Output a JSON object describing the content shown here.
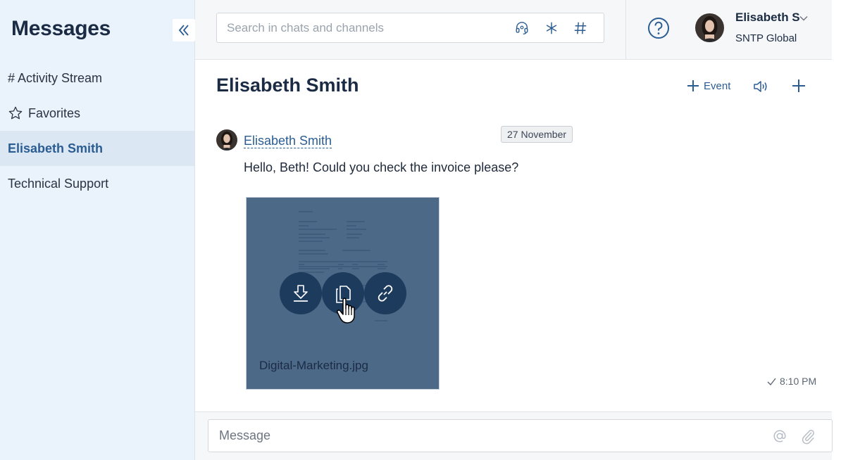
{
  "sidebar": {
    "title": "Messages",
    "items": [
      {
        "label": "# Activity Stream",
        "icon": ""
      },
      {
        "label": "Favorites",
        "icon": "star-icon"
      },
      {
        "label": "Elisabeth Smith",
        "icon": "",
        "active": true
      },
      {
        "label": "Technical Support",
        "icon": ""
      }
    ]
  },
  "search": {
    "placeholder": "Search in chats and channels",
    "icons": [
      "headset-icon",
      "asterisk-icon",
      "hashtag-icon"
    ]
  },
  "user": {
    "name": "Elisabeth S",
    "org": "SNTP Global"
  },
  "chat": {
    "title": "Elisabeth Smith",
    "event_label": "Event"
  },
  "message": {
    "author": "Elisabeth Smith",
    "date": "27 November",
    "text": "Hello, Beth! Could you check the invoice please?",
    "attachment": {
      "file_name": "Digital-Marketing.jpg",
      "actions": [
        "download-icon",
        "copy-icon",
        "link-icon"
      ]
    },
    "time": "8:10 PM"
  },
  "composer": {
    "placeholder": "Message"
  },
  "colors": {
    "sidebar_bg": "#eaf2fb",
    "accent": "#2b5d93",
    "overlay": "#26486e",
    "action_button": "#1d3b5c"
  }
}
